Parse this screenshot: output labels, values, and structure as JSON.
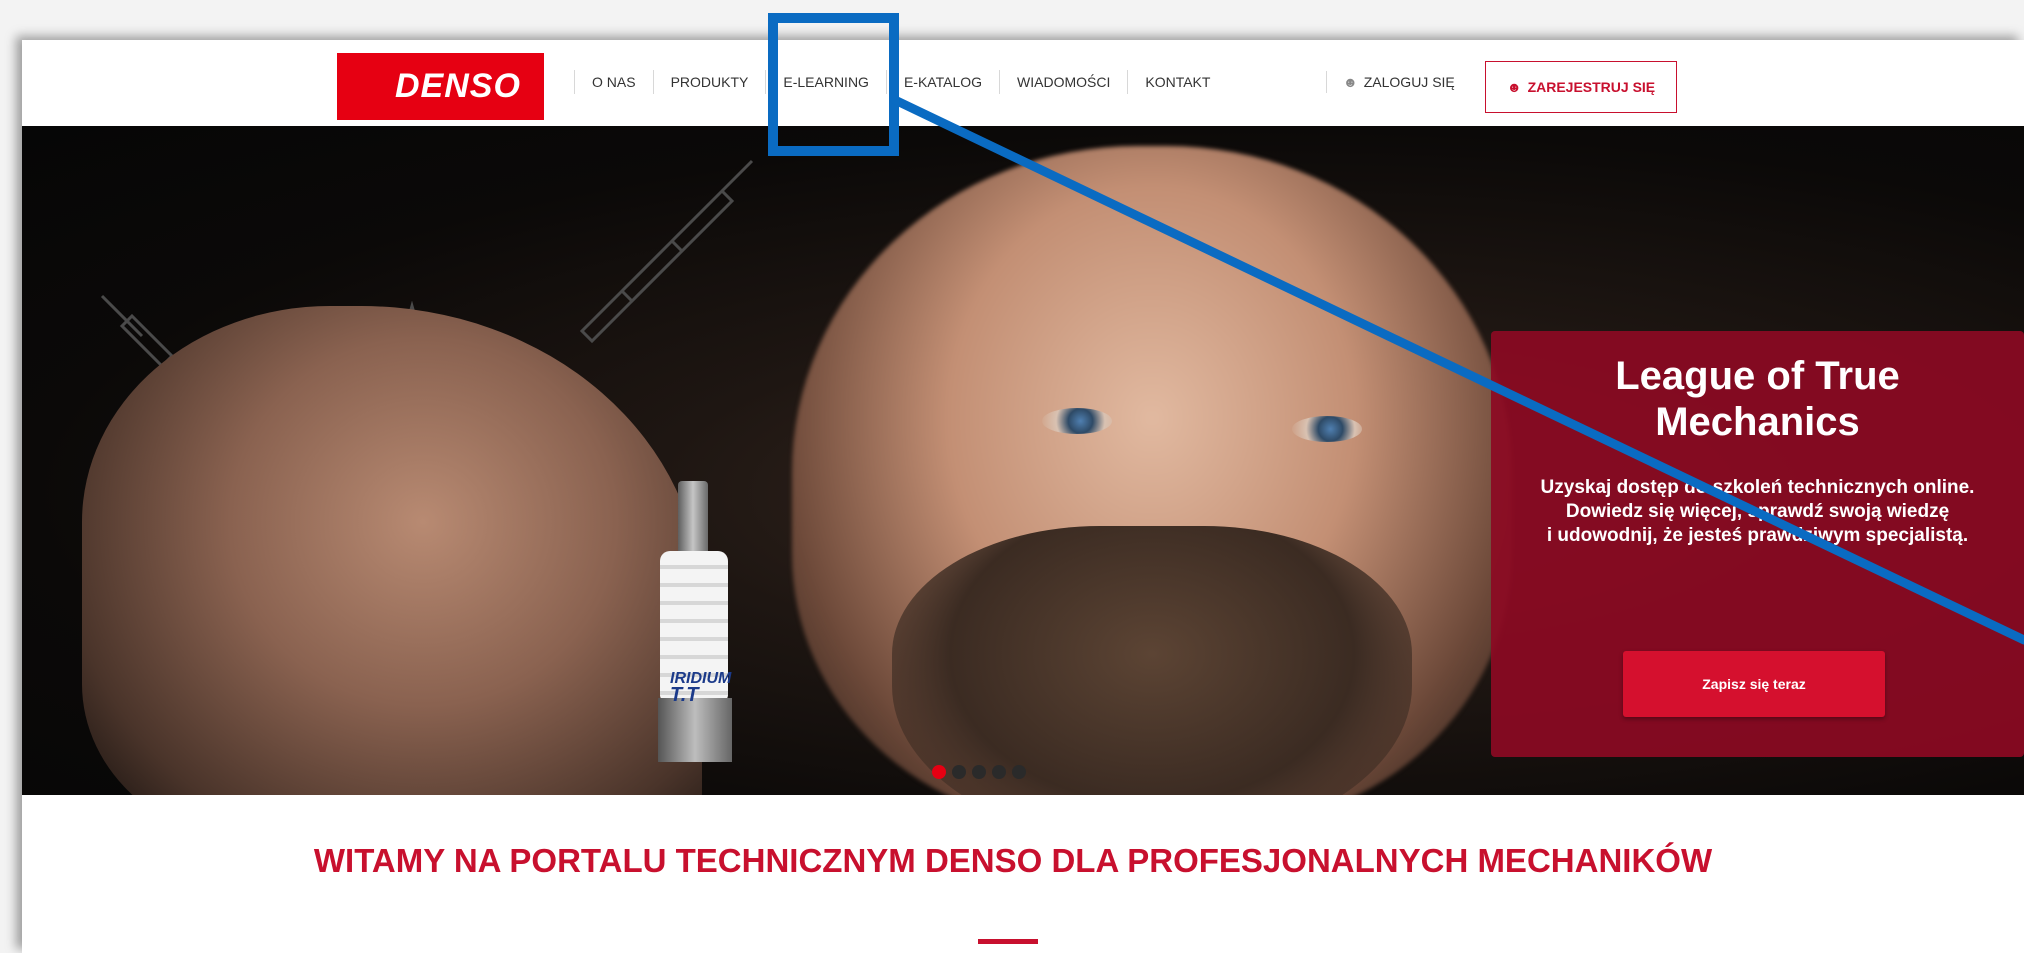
{
  "brand": {
    "logo_text": "DENSO",
    "primary_color": "#e60012",
    "accent_color": "#c8102e"
  },
  "nav": {
    "items": [
      {
        "label": "O NAS"
      },
      {
        "label": "PRODUKTY"
      },
      {
        "label": "E-LEARNING"
      },
      {
        "label": "E-KATALOG"
      },
      {
        "label": "WIADOMOŚCI"
      },
      {
        "label": "KONTAKT"
      }
    ],
    "login_label": "ZALOGUJ SIĘ",
    "register_label": "ZAREJESTRUJ SIĘ",
    "user_icon": "user-icon"
  },
  "hero": {
    "plug_label_line1": "IRIDIUM",
    "plug_label_line2": "T.T",
    "slides_total": 5,
    "active_slide": 1,
    "promo": {
      "title": "League of True Mechanics",
      "text": "Uzyskaj dostęp do szkoleń technicznych online. Dowiedz się więcej, sprawdź swoją wiedzę\ni udowodnij, że jesteś prawdziwym specjalistą.",
      "button_label": "Zapisz się teraz"
    }
  },
  "welcome": {
    "heading": "WITAMY NA PORTALU TECHNICZNYM DENSO DLA PROFESJONALNYCH MECHANIKÓW"
  },
  "annotation": {
    "highlight_color": "#0a6bc2"
  }
}
